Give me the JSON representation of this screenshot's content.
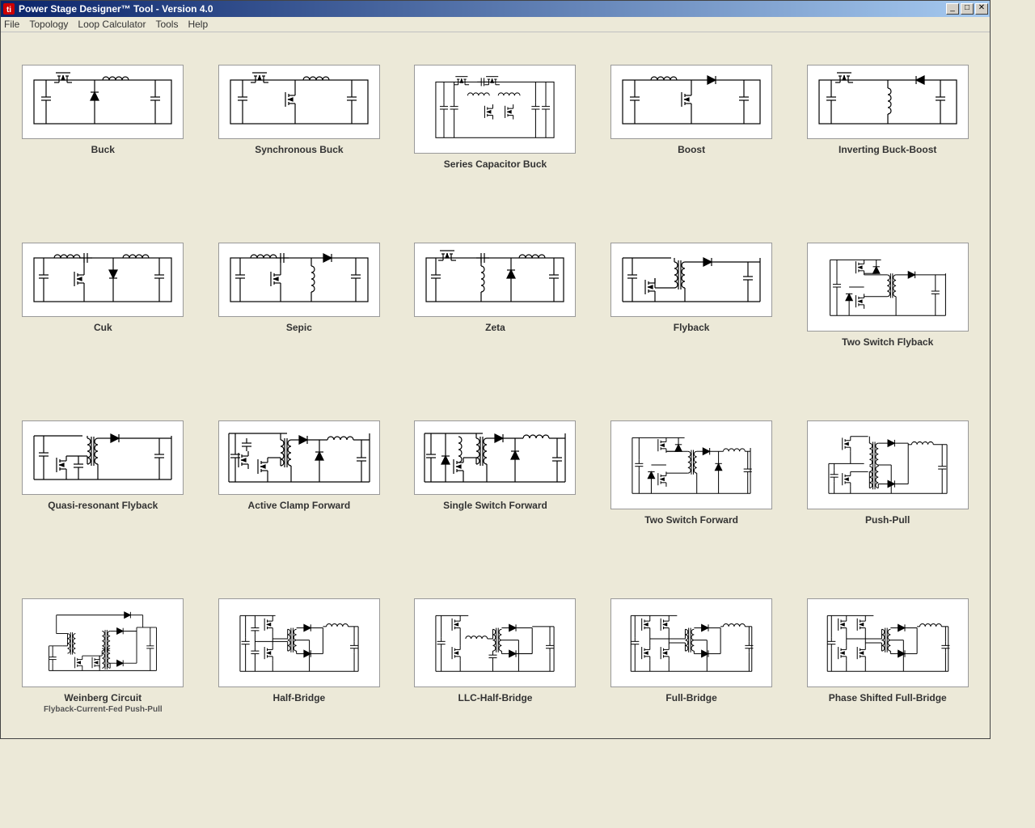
{
  "window": {
    "title": "Power Stage Designer™ Tool - Version 4.0"
  },
  "menu": {
    "items": [
      "File",
      "Topology",
      "Loop Calculator",
      "Tools",
      "Help"
    ]
  },
  "topologies": [
    {
      "id": "buck",
      "label": "Buck"
    },
    {
      "id": "sync-buck",
      "label": "Synchronous Buck"
    },
    {
      "id": "series-cap-buck",
      "label": "Series Capacitor Buck"
    },
    {
      "id": "boost",
      "label": "Boost"
    },
    {
      "id": "inv-buck-boost",
      "label": "Inverting Buck-Boost"
    },
    {
      "id": "cuk",
      "label": "Cuk"
    },
    {
      "id": "sepic",
      "label": "Sepic"
    },
    {
      "id": "zeta",
      "label": "Zeta"
    },
    {
      "id": "flyback",
      "label": "Flyback"
    },
    {
      "id": "two-sw-flyback",
      "label": "Two Switch Flyback"
    },
    {
      "id": "qr-flyback",
      "label": "Quasi-resonant Flyback"
    },
    {
      "id": "act-clamp-fwd",
      "label": "Active Clamp Forward"
    },
    {
      "id": "single-sw-fwd",
      "label": "Single Switch Forward"
    },
    {
      "id": "two-sw-fwd",
      "label": "Two Switch Forward"
    },
    {
      "id": "push-pull",
      "label": "Push-Pull"
    },
    {
      "id": "weinberg",
      "label": "Weinberg Circuit",
      "sublabel": "Flyback-Current-Fed Push-Pull"
    },
    {
      "id": "half-bridge",
      "label": "Half-Bridge"
    },
    {
      "id": "llc-half-bridge",
      "label": "LLC-Half-Bridge"
    },
    {
      "id": "full-bridge",
      "label": "Full-Bridge"
    },
    {
      "id": "ps-full-bridge",
      "label": "Phase Shifted Full-Bridge"
    }
  ]
}
